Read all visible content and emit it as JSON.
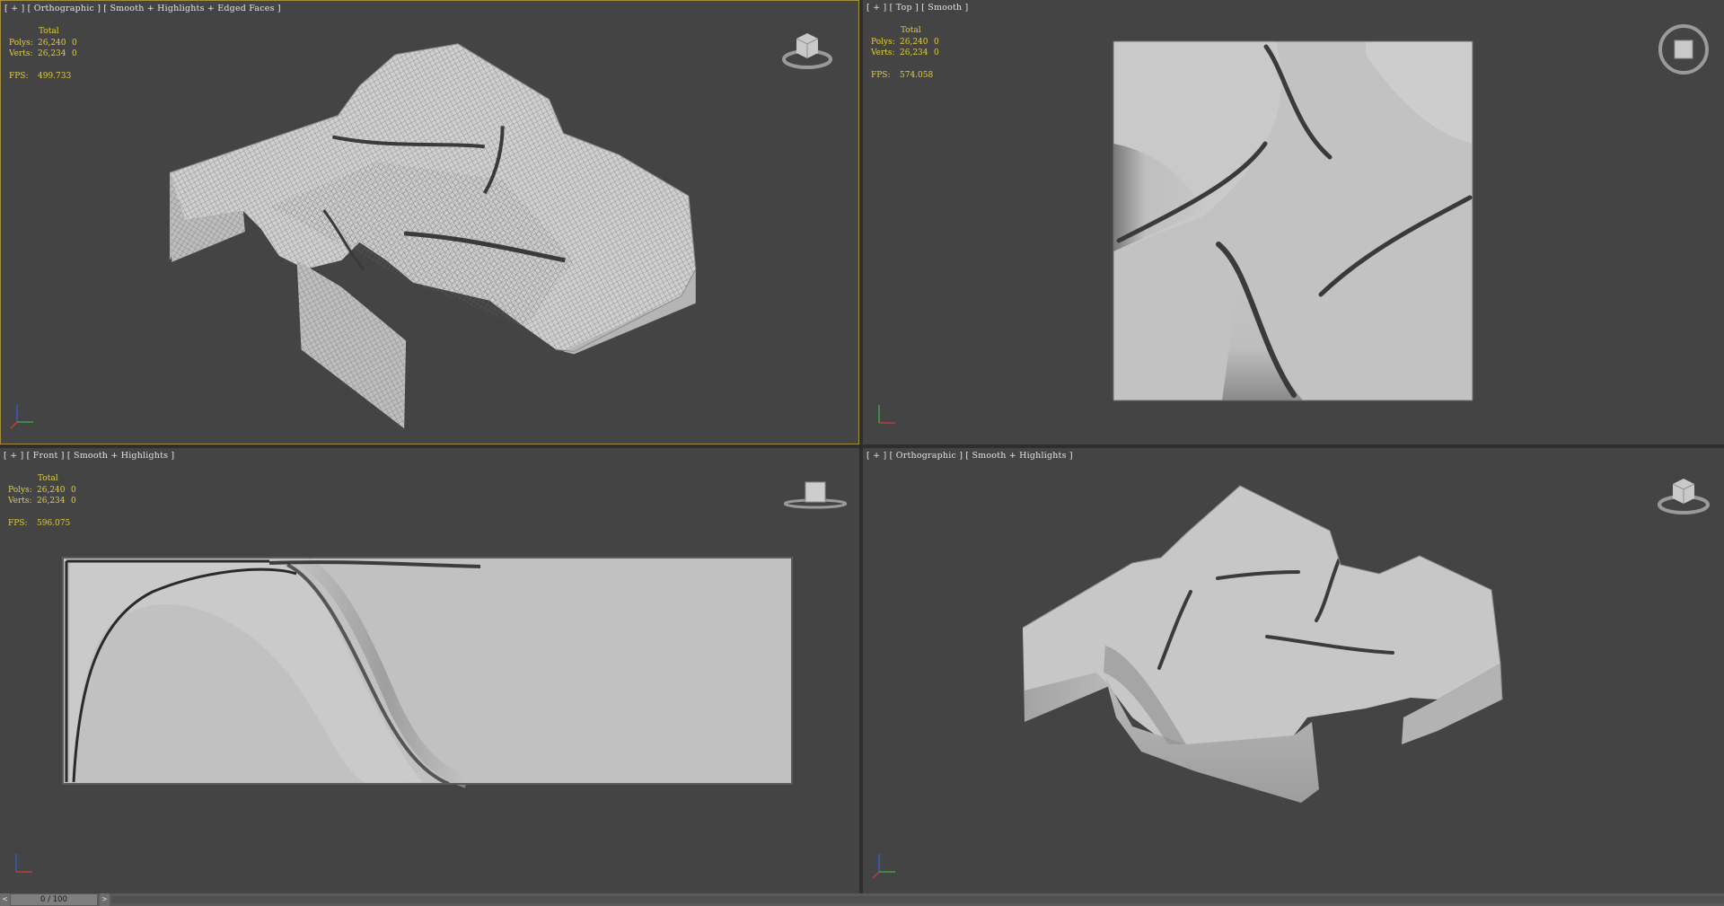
{
  "viewports": [
    {
      "id": "tl",
      "label": "[ + ] [ Orthographic ] [ Smooth + Highlights + Edged Faces ]",
      "total_label": "Total",
      "polys_label": "Polys:",
      "polys_value": "26,240",
      "polys_sel": "0",
      "verts_label": "Verts:",
      "verts_value": "26,234",
      "verts_sel": "0",
      "fps_label": "FPS:",
      "fps_value": "499.733",
      "active": true
    },
    {
      "id": "tr",
      "label": "[ + ] [ Top ] [ Smooth ]",
      "total_label": "Total",
      "polys_label": "Polys:",
      "polys_value": "26,240",
      "polys_sel": "0",
      "verts_label": "Verts:",
      "verts_value": "26,234",
      "verts_sel": "0",
      "fps_label": "FPS:",
      "fps_value": "574.058",
      "active": false
    },
    {
      "id": "bl",
      "label": "[ + ] [ Front ] [ Smooth + Highlights ]",
      "total_label": "Total",
      "polys_label": "Polys:",
      "polys_value": "26,240",
      "polys_sel": "0",
      "verts_label": "Verts:",
      "verts_value": "26,234",
      "verts_sel": "0",
      "fps_label": "FPS:",
      "fps_value": "596.075",
      "active": false
    },
    {
      "id": "br",
      "label": "[ + ] [ Orthographic ] [ Smooth + Highlights ]",
      "active": false
    }
  ],
  "time_slider": {
    "prev": "<",
    "value": "0 / 100",
    "next": ">"
  },
  "colors": {
    "viewport_bg": "#444444",
    "active_border": "#a58f3d",
    "stats_text": "#e2cf3a",
    "label_text": "#e3e3e3",
    "model_surface": "#c4c4c4"
  },
  "icons": {
    "viewcube": "viewcube-icon",
    "axis_tripod": "axis-tripod-icon"
  }
}
